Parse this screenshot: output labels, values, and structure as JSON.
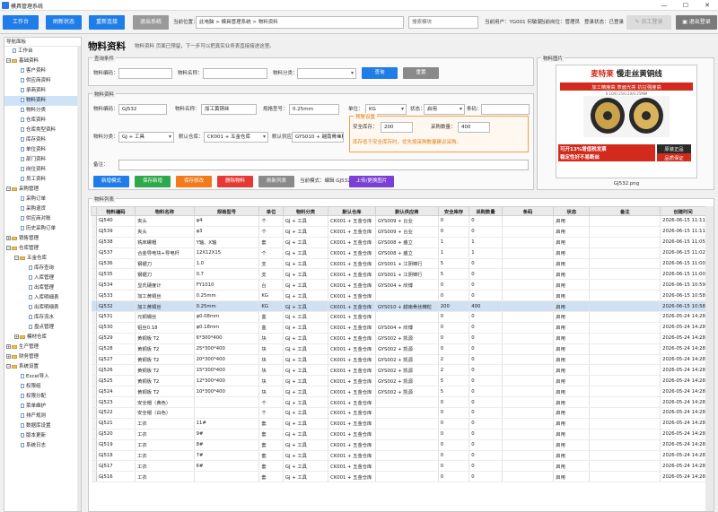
{
  "app": {
    "title": "模具管理系统",
    "controls": [
      "—",
      "☐",
      "✕"
    ]
  },
  "toolbar": {
    "buttons": [
      "工作台",
      "刷新状态",
      "重新连接",
      "退出系统"
    ],
    "location_label": "当前位置：",
    "location": "此电脑 > 模具管理系统 > 物料资料",
    "search_placeholder": "搜索模块",
    "user_label": "当前用户：YG001 何敏家",
    "position_label": "当前岗位：管理员",
    "login_label": "登录状态：已登录",
    "right_buttons": [
      "员工登录",
      "退出登录"
    ]
  },
  "sidebar": {
    "header": "导航面板",
    "items": [
      {
        "label": "工作台",
        "level": 0,
        "type": "doc"
      },
      {
        "label": "基础资料",
        "level": 0,
        "type": "folder",
        "open": true
      },
      {
        "label": "客户资料",
        "level": 1,
        "type": "doc"
      },
      {
        "label": "供应商资料",
        "level": 1,
        "type": "doc"
      },
      {
        "label": "承商资料",
        "level": 1,
        "type": "doc"
      },
      {
        "label": "物料资料",
        "level": 1,
        "type": "doc",
        "selected": true
      },
      {
        "label": "物料分类",
        "level": 1,
        "type": "doc"
      },
      {
        "label": "仓库资料",
        "level": 1,
        "type": "doc"
      },
      {
        "label": "仓库类型资料",
        "level": 1,
        "type": "doc"
      },
      {
        "label": "库存资料",
        "level": 1,
        "type": "doc"
      },
      {
        "label": "单位资料",
        "level": 1,
        "type": "doc"
      },
      {
        "label": "部门资料",
        "level": 1,
        "type": "doc"
      },
      {
        "label": "岗位资料",
        "level": 1,
        "type": "doc"
      },
      {
        "label": "员工资料",
        "level": 1,
        "type": "doc"
      },
      {
        "label": "采购管理",
        "level": 0,
        "type": "folder",
        "open": true
      },
      {
        "label": "采购订单",
        "level": 1,
        "type": "doc"
      },
      {
        "label": "采购退货",
        "level": 1,
        "type": "doc"
      },
      {
        "label": "供应商对账",
        "level": 1,
        "type": "doc"
      },
      {
        "label": "历史采购订单",
        "level": 1,
        "type": "doc"
      },
      {
        "label": "销售管理",
        "level": 0,
        "type": "folder",
        "open": false
      },
      {
        "label": "仓库管理",
        "level": 0,
        "type": "folder",
        "open": true
      },
      {
        "label": "五金仓库",
        "level": 1,
        "type": "folder",
        "open": true
      },
      {
        "label": "库存查询",
        "level": 2,
        "type": "doc"
      },
      {
        "label": "入库管理",
        "level": 2,
        "type": "doc"
      },
      {
        "label": "出库管理",
        "level": 2,
        "type": "doc"
      },
      {
        "label": "入库明细表",
        "level": 2,
        "type": "doc"
      },
      {
        "label": "出库明细表",
        "level": 2,
        "type": "doc"
      },
      {
        "label": "库存流水",
        "level": 2,
        "type": "doc"
      },
      {
        "label": "盘点管理",
        "level": 2,
        "type": "doc"
      },
      {
        "label": "模材仓库",
        "level": 1,
        "type": "folder",
        "open": false
      },
      {
        "label": "生产管理",
        "level": 0,
        "type": "folder",
        "open": false
      },
      {
        "label": "财务管理",
        "level": 0,
        "type": "folder",
        "open": false
      },
      {
        "label": "系统设置",
        "level": 0,
        "type": "folder",
        "open": true
      },
      {
        "label": "Excel导入",
        "level": 1,
        "type": "doc"
      },
      {
        "label": "权限组",
        "level": 1,
        "type": "doc"
      },
      {
        "label": "权限分配",
        "level": 1,
        "type": "doc"
      },
      {
        "label": "菜单维护",
        "level": 1,
        "type": "doc"
      },
      {
        "label": "排产规则",
        "level": 1,
        "type": "doc"
      },
      {
        "label": "数据库设置",
        "level": 1,
        "type": "doc"
      },
      {
        "label": "版本更新",
        "level": 1,
        "type": "doc"
      },
      {
        "label": "系统日志",
        "level": 1,
        "type": "doc"
      }
    ]
  },
  "page": {
    "title": "物料资料",
    "desc": "物料资料 页面已预留，下一步可以把真实业务表直接接进这里。"
  },
  "query": {
    "group": "查询条件",
    "code_label": "物料编码：",
    "name_label": "物料名称：",
    "cat_label": "物料分类：",
    "code": "",
    "name": "",
    "cat": "",
    "query_btn": "查询",
    "reset_btn": "重置"
  },
  "form": {
    "group": "物料资料",
    "code_label": "物料编码：",
    "code": "GJ532",
    "name_label": "物料名称：",
    "name": "加工黄铜丝",
    "spec_label": "规格型号：",
    "spec": "0.25mm",
    "unit_label": "单位：",
    "unit": "KG",
    "status_label": "状态：",
    "status": "启用",
    "barcode_label": "条码：",
    "barcode": "",
    "cat_label": "物料分类：",
    "cat": "GJ + 工具",
    "wh_label": "默认仓库：",
    "wh": "CK001 + 五金仓库",
    "sup_label": "默认供应商：",
    "sup": "GYS010 + 越南骨丝精",
    "remark_label": "备注：",
    "remark": "",
    "warn_group": "预警设置",
    "safety_label": "安全库存：",
    "safety": "200",
    "purchase_label": "采购数量：",
    "purchase": "400",
    "warn_hint": "库存低于安全库存时，优先按采购数量建议采购。",
    "mode_label": "当前模式：编辑 GJ532",
    "buttons": [
      {
        "label": "新增模式",
        "color": "#1e7de8"
      },
      {
        "label": "保存新增",
        "color": "#2da84a"
      },
      {
        "label": "保存修改",
        "color": "#f27a1a"
      },
      {
        "label": "删除物料",
        "color": "#e53935"
      },
      {
        "label": "刷新列表",
        "color": "#8a8a8a"
      }
    ],
    "upload_btn": {
      "label": "上传/更换图片",
      "color": "#7b3fd6"
    }
  },
  "image": {
    "group": "物料图片",
    "product_title": "麦特莱 慢走丝黄铜线",
    "brand": "麦特莱",
    "line1": "加工精度高  表面光亮  抗拉强度高",
    "line2": "0.10/0.15/0.20/0.25MM",
    "promo1": "可开13%增值税发票",
    "promo2": "稳定性好不易断丝",
    "badge1": "原装正品",
    "badge2": "品质保证",
    "caption": "GJ532.png"
  },
  "list": {
    "group": "物料列表",
    "columns": [
      "物料编码",
      "物料名称",
      "规格型号",
      "单位",
      "物料分类",
      "默认仓库",
      "默认供应商",
      "安全库存",
      "采购数量",
      "条码",
      "状态",
      "备注",
      "创建时间"
    ],
    "rows": [
      [
        "GJ540",
        "夹头",
        "φ4",
        "个",
        "GJ + 工具",
        "CK001 + 五金仓库",
        "GYS009 + 台业",
        "0",
        "0",
        "",
        "启用",
        "",
        "2026-06-15 11:11"
      ],
      [
        "GJ539",
        "夹头",
        "φ3",
        "个",
        "GJ + 工具",
        "CK001 + 五金仓库",
        "GYS009 + 台业",
        "0",
        "0",
        "",
        "启用",
        "",
        "2026-06-15 11:11"
      ],
      [
        "GJ538",
        "铣床螺帽",
        "Y轴、X轴",
        "套",
        "GJ + 工具",
        "CK001 + 五金仓库",
        "GYS008 + 盛立",
        "1",
        "1",
        "",
        "启用",
        "",
        "2026-06-15 11:05"
      ],
      [
        "GJ537",
        "合金导电块+导电杆",
        "12X12X15",
        "个",
        "GJ + 工具",
        "CK001 + 五金仓库",
        "GYS008 + 盛立",
        "1",
        "1",
        "",
        "启用",
        "",
        "2026-06-15 11:02"
      ],
      [
        "GJ536",
        "钢锯刀",
        "1.0",
        "支",
        "GJ + 工具",
        "CK001 + 五金仓库",
        "GYS001 + 江阴锦行",
        "5",
        "0",
        "",
        "启用",
        "",
        "2026-06-15 11:00"
      ],
      [
        "GJ535",
        "钢锯刀",
        "0.7",
        "支",
        "GJ + 工具",
        "CK001 + 五金仓库",
        "GYS001 + 江阴锦行",
        "5",
        "0",
        "",
        "启用",
        "",
        "2026-06-15 11:00"
      ],
      [
        "GJ534",
        "显氏硬度计",
        "FY1010",
        "台",
        "GJ + 工具",
        "CK001 + 五金仓库",
        "GYS004 + 欣博",
        "0",
        "0",
        "",
        "启用",
        "",
        "2026-06-15 10:59"
      ],
      [
        "GJ533",
        "加工黄铜丝",
        "0.25mm",
        "KG",
        "GJ + 工具",
        "CK001 + 五金仓库",
        "",
        "0",
        "0",
        "",
        "启用",
        "",
        "2026-06-15 10:58"
      ],
      [
        "GJ532",
        "加工黄铜丝",
        "0.25mm",
        "KG",
        "GJ + 工具",
        "CK001 + 五金仓库",
        "GYS010 + 越南骨丝精粒",
        "200",
        "400",
        "",
        "启用",
        "",
        "2026-06-15 10:58"
      ],
      [
        "GJ531",
        "元铜锡丝",
        "φ0.08mm",
        "盒",
        "GJ + 工具",
        "CK001 + 五金仓库",
        "",
        "0",
        "0",
        "",
        "启用",
        "",
        "2026-05-24 14:28"
      ],
      [
        "GJ530",
        "铝丝0.18",
        "φ0.18mm",
        "盒",
        "GJ + 工具",
        "CK001 + 五金仓库",
        "GYS004 + 欣博",
        "0",
        "0",
        "",
        "启用",
        "",
        "2026-05-24 14:28"
      ],
      [
        "GJ529",
        "黄铜板 T2",
        "6*300*400",
        "块",
        "GJ + 工具",
        "CK001 + 五金仓库",
        "GYS002 + 凯源",
        "0",
        "0",
        "",
        "启用",
        "",
        "2026-05-24 14:28"
      ],
      [
        "GJ528",
        "黄铜板 T2",
        "25*300*400",
        "块",
        "GJ + 工具",
        "CK001 + 五金仓库",
        "GYS002 + 凯源",
        "0",
        "0",
        "",
        "启用",
        "",
        "2026-05-24 14:28"
      ],
      [
        "GJ527",
        "黄铜板 T2",
        "20*300*400",
        "块",
        "GJ + 工具",
        "CK001 + 五金仓库",
        "GYS002 + 凯源",
        "2",
        "0",
        "",
        "启用",
        "",
        "2026-05-24 14:28"
      ],
      [
        "GJ526",
        "黄铜板 T2",
        "15*300*400",
        "块",
        "GJ + 工具",
        "CK001 + 五金仓库",
        "GYS002 + 凯源",
        "2",
        "0",
        "",
        "启用",
        "",
        "2026-05-24 14:28"
      ],
      [
        "GJ525",
        "黄铜板 T2",
        "12*300*400",
        "块",
        "GJ + 工具",
        "CK001 + 五金仓库",
        "GYS002 + 凯源",
        "5",
        "0",
        "",
        "启用",
        "",
        "2026-05-24 14:28"
      ],
      [
        "GJ524",
        "黄铜板 T2",
        "10*300*400",
        "块",
        "GJ + 工具",
        "CK001 + 五金仓库",
        "GYS002 + 凯源",
        "5",
        "0",
        "",
        "启用",
        "",
        "2026-05-24 14:28"
      ],
      [
        "GJ523",
        "安全帽（黄色）",
        "",
        "个",
        "GJ + 工具",
        "CK001 + 五金仓库",
        "",
        "0",
        "0",
        "",
        "启用",
        "",
        "2026-05-24 14:28"
      ],
      [
        "GJ522",
        "安全帽（白色）",
        "",
        "个",
        "GJ + 工具",
        "CK001 + 五金仓库",
        "",
        "0",
        "0",
        "",
        "启用",
        "",
        "2026-05-24 14:28"
      ],
      [
        "GJ521",
        "工衣",
        "11#",
        "套",
        "GJ + 工具",
        "CK001 + 五金仓库",
        "",
        "0",
        "0",
        "",
        "启用",
        "",
        "2026-05-24 14:28"
      ],
      [
        "GJ520",
        "工衣",
        "9#",
        "套",
        "GJ + 工具",
        "CK001 + 五金仓库",
        "",
        "0",
        "0",
        "",
        "启用",
        "",
        "2026-05-24 14:28"
      ],
      [
        "GJ519",
        "工衣",
        "8#",
        "套",
        "GJ + 工具",
        "CK001 + 五金仓库",
        "",
        "0",
        "0",
        "",
        "启用",
        "",
        "2026-05-24 14:28"
      ],
      [
        "GJ518",
        "工衣",
        "7#",
        "套",
        "GJ + 工具",
        "CK001 + 五金仓库",
        "",
        "0",
        "0",
        "",
        "启用",
        "",
        "2026-05-24 14:28"
      ],
      [
        "GJ517",
        "工衣",
        "6#",
        "套",
        "GJ + 工具",
        "CK001 + 五金仓库",
        "",
        "0",
        "0",
        "",
        "启用",
        "",
        "2026-05-24 14:28"
      ],
      [
        "GJ516",
        "工衣",
        "",
        "套",
        "GJ + 工具",
        "CK001 + 五金仓库",
        "",
        "0",
        "0",
        "",
        "启用",
        "",
        "2026-05-24 14:28"
      ]
    ],
    "selected_index": 8
  }
}
